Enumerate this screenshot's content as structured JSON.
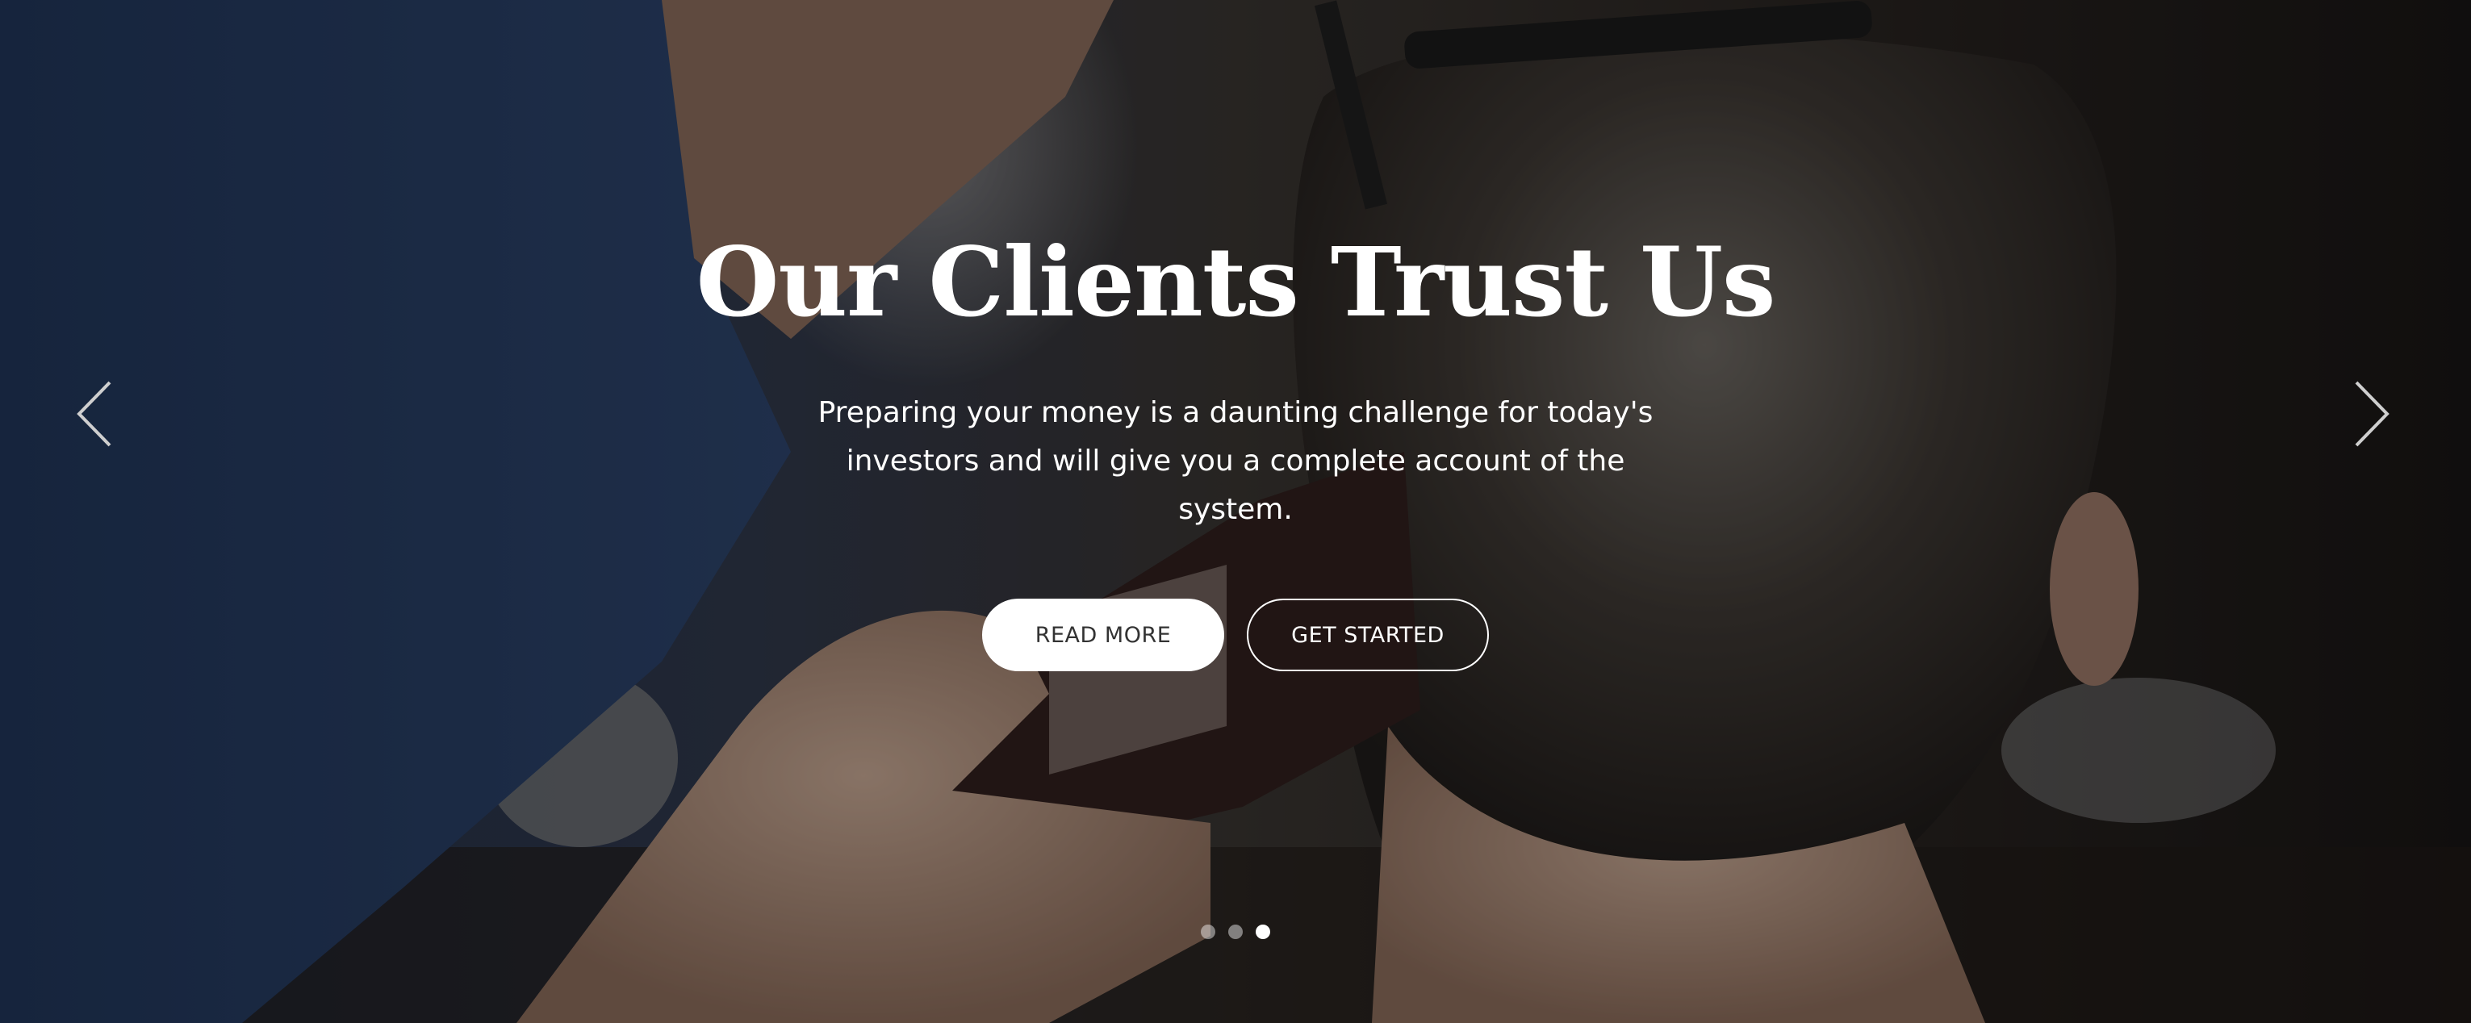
{
  "hero": {
    "title": "Our Clients Trust Us",
    "subtitle_line1": "Preparing your money is a daunting challenge for today's",
    "subtitle_line2": "investors and will give you a complete account of the system.",
    "buttons": {
      "read_more": "READ MORE",
      "get_started": "GET STARTED"
    }
  },
  "carousel": {
    "prev_icon": "chevron-left-icon",
    "next_icon": "chevron-right-icon",
    "slide_count": 3,
    "active_slide": 3
  },
  "colors": {
    "text": "#ffffff",
    "primary_button_bg": "#ffffff",
    "primary_button_text": "#333333"
  }
}
